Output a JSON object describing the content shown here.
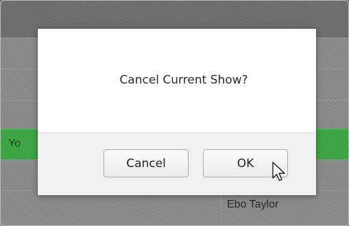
{
  "background_table": {
    "active_row_text": "Yo",
    "row_artist_text": "Ebo Taylor",
    "active_row_color": "#3aa642"
  },
  "dialog": {
    "message": "Cancel Current Show?",
    "cancel_label": "Cancel",
    "ok_label": "OK"
  },
  "cursor": {
    "icon": "arrow-pointer-icon"
  }
}
